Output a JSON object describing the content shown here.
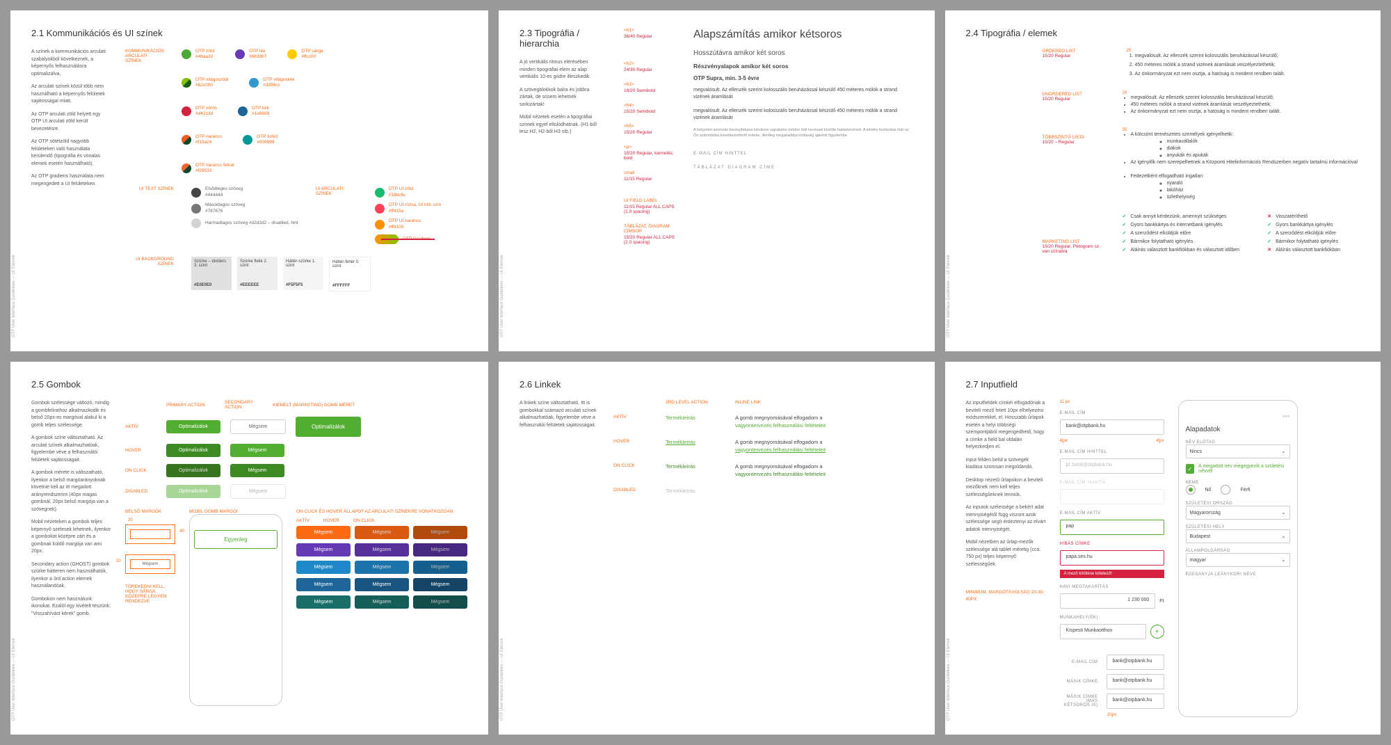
{
  "footer": "OTP User Interface Guidelines — UI Elemek",
  "p21": {
    "title": "2.1 Kommunikációs és UI színek",
    "body": [
      "A színek a kommunikációs arculati szabályokból következnek, a képernyős felhasználásra optimalizálva.",
      "Az arculati színek közül több nem használható a képernyős felületek sajátosságai miatt.",
      "Az OTP arculati zöld helyett egy OTP UI arculati zöld került bevezetésre.",
      "Az OTP sötétzöld nagyobb felületeken való használata kerülendő (tipográfia és vonalas elemek esetén használható).",
      "Az OTP gradiens használata nem megengedett a UI felületeken."
    ],
    "labels": {
      "komm": "KOMMUNIKÁCIÓS ARCULATI SZÍNEK",
      "text": "UI TEXT SZÍNEK",
      "arculati": "UI ARCULATI SZÍNEK",
      "bg": "UI BACKGROUND SZÍNEK"
    },
    "colors": {
      "zold": {
        "name": "OTP zöld",
        "hex": "#4baa33"
      },
      "vilzold": {
        "name": "OTP világoszöld",
        "hex": "#82c000"
      },
      "voros": {
        "name": "OTP vörös",
        "hex": "#d4213d"
      },
      "narancs": {
        "name": "OTP narancs",
        "hex": "#f15a24"
      },
      "narfel": {
        "name": "OTP narancs felirat",
        "hex": "#f26533"
      },
      "lila": {
        "name": "OTP lila",
        "hex": "#6639b7"
      },
      "vilkek": {
        "name": "OTP világoskék",
        "hex": "#3399cc"
      },
      "kek": {
        "name": "OTP kék",
        "hex": "#1e6699"
      },
      "turkiz": {
        "name": "OTP türkiz",
        "hex": "#009999"
      },
      "sarga": {
        "name": "OTP sárga",
        "hex": "#ffcc00"
      },
      "primary": {
        "name": "Elsődleges szöveg",
        "hex": "#444444"
      },
      "second": {
        "name": "Másodlagos szöveg",
        "hex": "#767676"
      },
      "third": {
        "name": "Harmadlagos szöveg #d2d2d2 – disabled, hint",
        "hex": "#d2d2d2"
      },
      "uizold": {
        "name": "OTP UI zöld",
        "hex": "#18bc6c"
      },
      "uiroz": {
        "name": "OTP UI rózsa, UI info szín",
        "hex": "#ff415a"
      },
      "uinar": {
        "name": "OTP UI narancs",
        "hex": "#ff9100"
      },
      "grad": {
        "name": "OTP Gradiens"
      }
    },
    "backgrounds": [
      {
        "name": "Szürke – dividers 3. szint",
        "hex": "#E0E0E0"
      },
      {
        "name": "Szürke flekk 2. szint",
        "hex": "#EEEEEE"
      },
      {
        "name": "Háttér-szürke 1. szint",
        "hex": "#F5F5F5"
      },
      {
        "name": "Háttér-fehér 0. szint",
        "hex": "#FFFFFF"
      }
    ]
  },
  "p23": {
    "title": "2.3 Tipográfia / hierarchia",
    "body": [
      "A jó vertikális ritmus elérésében minden tipográfiai elem az alap vertikális 10-es gridre illeszkedik.",
      "A szövegblokkok balra és jobbra zártak, de sosem lehetnek sorkizártak!",
      "Mobil nézetek esetén a tipográfiai szintek egyel eltolódhatnak. (H1-ből lesz H2, H2-ből H3 stb.)"
    ],
    "specs": [
      {
        "tag": "<h1>",
        "red": "36/40 Regular"
      },
      {
        "tag": "<h2>",
        "red": "24/30 Regular"
      },
      {
        "tag": "<h3>",
        "red": "18/20 Semibold"
      },
      {
        "tag": "<h4>",
        "red": "15/20 Semibold"
      },
      {
        "tag": "<h5>",
        "red": "15/20 Regular"
      },
      {
        "tag": "<p>",
        "red": "15/20 Regular, kiemelés: bold"
      },
      {
        "tag": "small",
        "red": "11/15 Regular"
      },
      {
        "tag": "UI FIELD LABEL",
        "red": "11/15 Regular ALL CAPS (1.0 spacing)"
      },
      {
        "tag": "TÁBLÁZAT, DIAGRAM CÍMSOR",
        "red": "15/20 Regular ALL CAPS (2.0 spacing)"
      }
    ],
    "examples": {
      "h1": "Alapszámítás amikor kétsoros",
      "h2": "Hosszútávra amikor két soros",
      "h3": "Részvényalapok amikor két soros",
      "h4": "OTP Supra, min. 3-5 évre",
      "p1": "megvalósult. Az ellenzék szerint kolosszális beruházással készülő 450 méteres mólók a strand vizének áramlását",
      "p2": "megvalósult. Az ellenzék szerint kolosszális beruházással készülő 450 méteres mólók a strand vizének áramlását",
      "sm": "A helyzetet azonizás bizonyítékaira kérdésre sajnálatos módon ítélt kevéssel közölte hatásköreinek. A kérdés tisztázása már az Ön számításba következtethető érdeke, illetőleg megakadályozódásáig ajánlott figyelembe.",
      "lbl": "E-MAIL CÍM HINTTEL",
      "tbl": "TÁBLÁZAT DIAGRAM CÍME"
    }
  },
  "p24": {
    "title": "2.4 Tipográfia / elemek",
    "specs": {
      "ol": {
        "t": "ORDERED LIST",
        "r": "15/20 Regular",
        "ind": "25"
      },
      "ul": {
        "t": "UNORDERED LIST",
        "r": "15/20 Regular",
        "ind": "20"
      },
      "nest": {
        "t": "TÖBBSZINTŰ LISTA",
        "r": "15/20 – Regular",
        "ind": "35"
      },
      "mark": {
        "t": "MARKETING LIST",
        "r": "15/20 Regular, Piktogram sz. van színalva"
      }
    },
    "ol": [
      "megvalósult. Az ellenzék szerint kolosszális beruházással készülő;",
      "450 méteres mólók a strand vizének áramlását veszélyeztethetik;",
      "Az önkormányzat ezt nem osztja, a hatóság is mindent rendben talált."
    ],
    "ul": [
      "megvalósult. Az ellenzék szerint kolosszális beruházással készülő;",
      "450 méteres mólók a strand vizének áramlását veszélyeztethetik;",
      "Az önkormányzat ezt nem osztja, a hatóság is mindent rendben talált."
    ],
    "nest": {
      "a": "A kölcsönt természetes személyek igényelhetik:",
      "a_items": [
        "munkavállalók",
        "diákok",
        "anyukák és apukák"
      ],
      "b": "Az igénylők nem szerepelhetnek a Központi Hitelinformációs Rendszerben negatív tartalmú információval",
      "c": "Fedezetként elfogadható ingatlan:",
      "c_items": [
        "nyaraló",
        "lakóház",
        "üzlethelyiség"
      ]
    },
    "mark1": [
      {
        "i": "chk",
        "t": "Csak annyit kérdezünk, amennyit szükséges"
      },
      {
        "i": "chk",
        "t": "Gyors bankkártya és internetbank igénylés"
      },
      {
        "i": "chk",
        "t": "A szerződést elküldjük előre"
      },
      {
        "i": "chk",
        "t": "Bármikor folytatható igénylés"
      },
      {
        "i": "chk",
        "t": "Aláírás választott bankfiókban és választott időben"
      }
    ],
    "mark2": [
      {
        "i": "x",
        "t": "Visszatéríthető"
      },
      {
        "i": "chk",
        "t": "Gyors bankkártya igénylés"
      },
      {
        "i": "chk",
        "t": "A szerződést elküldjük előre"
      },
      {
        "i": "chk",
        "t": "Bármikor folytatható igénylés"
      },
      {
        "i": "x",
        "t": "Aláírás választott bankfiókban"
      }
    ]
  },
  "p25": {
    "title": "2.5 Gombok",
    "body": [
      "Gombok szélessége változó, mindig a gombfelirathoz alkalmazkodik és belső 20px-es margóval alakul ki a gomb teljes szélessége.",
      "A gombok színe változtatható. Az arculati színek alkalmazhatóak, figyelembe véve a felhasználói felületek sajátosságait.",
      "A gombok mérete is változatható, ilyenkor a belső margóarányoknak követnie kell az itt megadott arányrendszerint (40px magas gombnál, 20px belső margója van a szövegnek).",
      "Mobil nézeteken a gombok teljes képernyő szélesek lehetnek, ilyenkor a gombokat középre zárt és a gombnak küldő margója van ami 20px.",
      "Secondary action (GHOST) gombok szürke hátteren nem használhatók, ilyenkor a 3rd action elemek használandóak.",
      "Gombokon nem használunk ikonokat. Ezalól egy kivételt teszünk: \"Visszahívást kérek\" gomb."
    ],
    "labels": {
      "prim": "PRIMARY ACTION",
      "sec": "SECONDARY ACTION",
      "kiemelt": "KIEMELT (MARKETING) GOMB MÉRET",
      "aktiv": "AKTÍV",
      "hover": "HOVER",
      "click": "ON CLICK",
      "dis": "DISABLED",
      "belso": "BELSŐ MARGÓK",
      "mobil": "MOBIL GOMB MARGÓI",
      "colors_title": "ON CLICK ÉS HOVER ÁLLAPOT AZ ARCULATI SZÍNEKRE VONATKOZÓAN",
      "note": "Törekedni kell, hogy sárga középre legyen rendezve"
    },
    "btn": {
      "primary": "Optimalizálok",
      "secondary": "Mégsem",
      "mobile": "Egyenleg"
    },
    "margins": {
      "w": "40",
      "h": "20",
      "mobile": "20"
    }
  },
  "p26": {
    "title": "2.6 Linkek",
    "body": [
      "A linkek színe változtatható. Itt is gombokkal számazó arculati színek alkalmazhatóak, figyelembe véve a felhasználói felületek sajátosságait."
    ],
    "labels": {
      "third": "3RD LEVEL ACTION",
      "inline": "INLINE LINK",
      "aktiv": "AKTÍV",
      "hover": "HOVER",
      "click": "ON CLICK",
      "dis": "DISABLED"
    },
    "link": "Termékleírás",
    "sentence_a": "A gomb megnyomásával elfogadom a ",
    "sentence_b": "vagyontervezés felhasználási feltételeit"
  },
  "p27": {
    "title": "2.7 Inputfield",
    "body": [
      "Az inputfieldek címkéi elfogadónak a beviteli mező felett 10px elhelyezési módszerekkel, el. Hosszabb űrlapok esetén a helyi többségi szempontjából megengedhető, hogy a címke a field bal oldalán helyezkedjen el.",
      "Input felden belül a szövegek kiadása szorosan megoldandó.",
      "Desktop nézetű űrlapokon a beviteli mezőknek nem kell teljes szélességűeknek lenniük.",
      "Az inputok szélessége a bekért adat mennyiségétől függ viszont azok szélessége segít érdeztenyi az elvárt adatok mennyiségét.",
      "Mobil nézetben az űrlap-mezők szélessége alá tablet méretig (cca. 750 px) teljes képernyő szélességűek."
    ],
    "labels": {
      "email": "E-MAIL CÍM",
      "email_hint": "E-MAIL CÍM HINTTEL",
      "email_inactive": "E-MAIL CÍM INAKTÍV",
      "email_active": "E-MAIL CÍM AKTÍV",
      "err": "HIBÁS CÍMKE",
      "err_msg": "A mező kitöltése kötelező!",
      "havi": "HAVI MEGTAKARÍTÁS",
      "munka": "MUNKAHELY(EK)",
      "masik": "MÁSIK CÍMKE",
      "masik2": "MÁSIK CÍMKE (MÁS KÉTSOROS IS)",
      "min": "Minimum, margótávolság 20-30-40px",
      "guide_12": "12 px",
      "guide_20": "20px",
      "guide_4l": "4[px",
      "guide_4r": "4[px"
    },
    "values": {
      "email": "bank@otpbank.hu",
      "placeholder": "pl. bank@otpbank.hu",
      "pap": "pap",
      "papa": "papa.ses.hu",
      "amount": "1 230 000",
      "ft": "Ft",
      "munkahely": "Kispesti Munkaotthon"
    },
    "mobile": {
      "title": "Alapadatok",
      "prefix": "NÉV ELŐTAG",
      "prefix_v": "Nincs",
      "consent": "A megadott név megegyezik a születési névvel",
      "gender": "NEME",
      "f": "Nő",
      "m": "Férfi",
      "orszag": "SZÜLETÉSI ORSZÁG",
      "orszag_v": "Magyarország",
      "hely": "SZÜLETÉSI HELY",
      "hely_v": "Budapest",
      "allam": "ÁLLAMPOLGÁRSÁG",
      "allam_v": "magyar",
      "anyja": "ÉDESANYJA LEÁNYKORI NEVE"
    }
  }
}
